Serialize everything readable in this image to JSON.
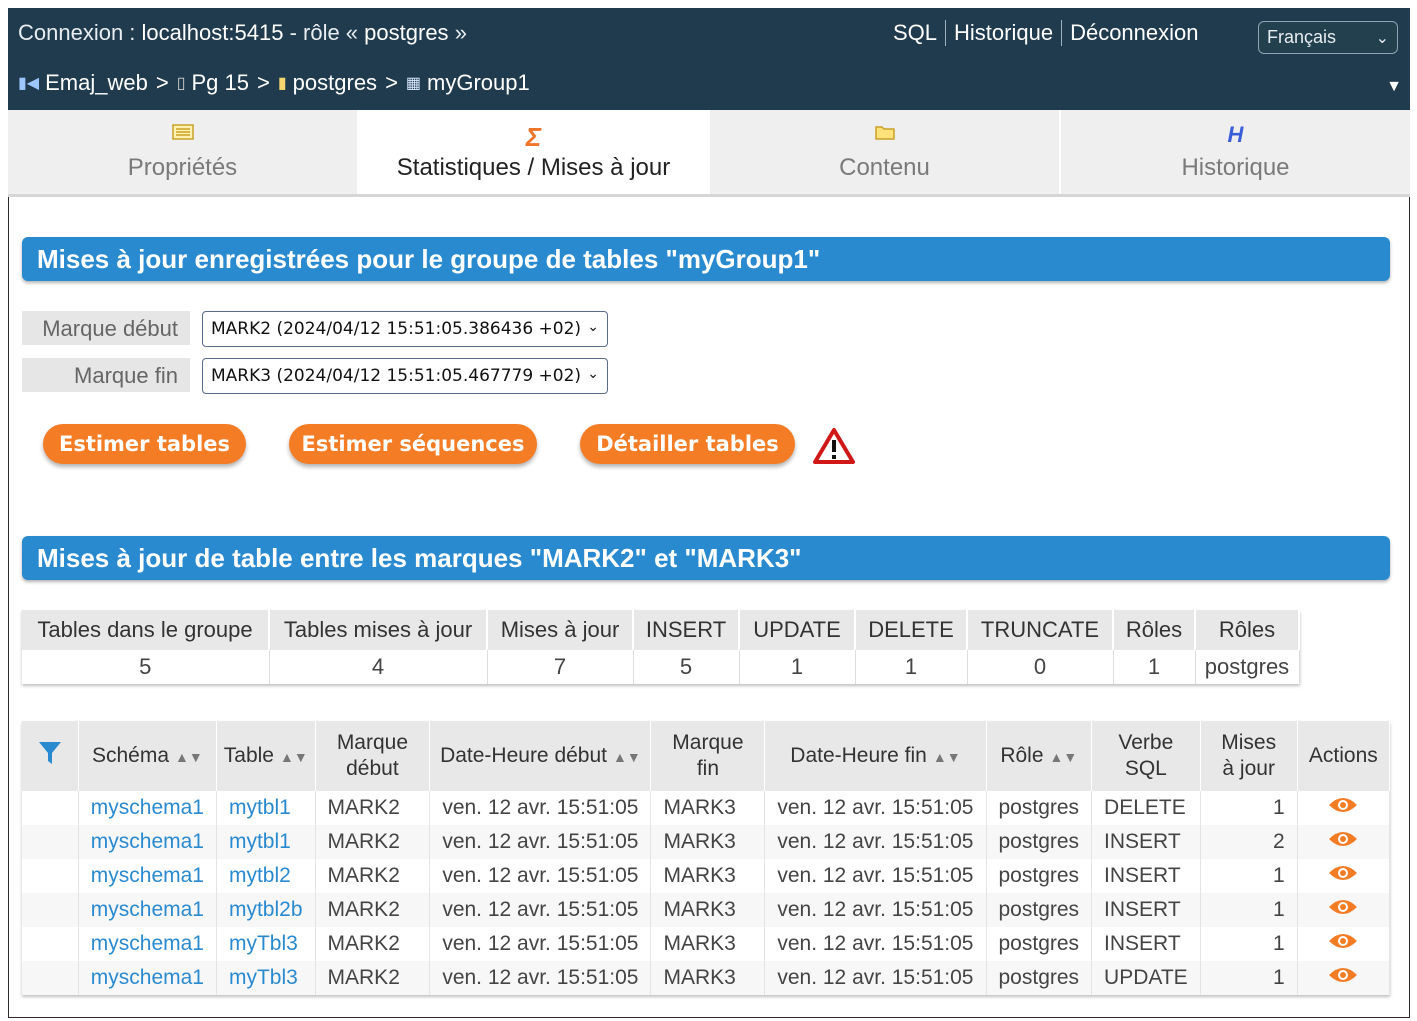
{
  "header": {
    "connection_prefix": "Connexion :",
    "host": "localhost:5415",
    "role_prefix": "- rôle «",
    "role": "postgres",
    "role_suffix": "»",
    "links": [
      "SQL",
      "Historique",
      "Déconnexion"
    ],
    "language": "Français"
  },
  "breadcrumb": {
    "items": [
      "Emaj_web",
      "Pg 15",
      "postgres",
      "myGroup1"
    ],
    "separator": ">"
  },
  "tabs": [
    {
      "label": "Propriétés",
      "icon": "properties-icon"
    },
    {
      "label": "Statistiques / Mises à jour",
      "icon": "sigma-icon",
      "active": true
    },
    {
      "label": "Contenu",
      "icon": "folder-icon"
    },
    {
      "label": "Historique",
      "icon": "history-icon",
      "glyph": "H"
    }
  ],
  "section1": {
    "title": "Mises à jour enregistrées pour le groupe de tables \"myGroup1\"",
    "mark_start_label": "Marque début",
    "mark_start_value": "MARK2 (2024/04/12 15:51:05.386436 +02)",
    "mark_end_label": "Marque fin",
    "mark_end_value": "MARK3 (2024/04/12 15:51:05.467779 +02)",
    "buttons": [
      "Estimer tables",
      "Estimer séquences",
      "Détailler tables"
    ]
  },
  "section2": {
    "title": "Mises à jour de table entre les marques \"MARK2\" et \"MARK3\""
  },
  "summary": {
    "headers": [
      "Tables dans le groupe",
      "Tables mises à jour",
      "Mises à jour",
      "INSERT",
      "UPDATE",
      "DELETE",
      "TRUNCATE",
      "Rôles",
      "Rôles"
    ],
    "values": [
      "5",
      "4",
      "7",
      "5",
      "1",
      "1",
      "0",
      "1",
      "postgres"
    ]
  },
  "details": {
    "headers": {
      "schema": "Schéma",
      "table": "Table",
      "mark_start_1": "Marque",
      "mark_start_2": "début",
      "datetime_start": "Date-Heure début",
      "mark_end_1": "Marque",
      "mark_end_2": "fin",
      "datetime_end": "Date-Heure fin",
      "role": "Rôle",
      "verb_1": "Verbe",
      "verb_2": "SQL",
      "updates_1": "Mises",
      "updates_2": "à jour",
      "actions": "Actions"
    },
    "rows": [
      {
        "schema": "myschema1",
        "table": "mytbl1",
        "mark_start": "MARK2",
        "dt_start": "ven. 12 avr. 15:51:05",
        "mark_end": "MARK3",
        "dt_end": "ven. 12 avr. 15:51:05",
        "role": "postgres",
        "verb": "DELETE",
        "count": "1"
      },
      {
        "schema": "myschema1",
        "table": "mytbl1",
        "mark_start": "MARK2",
        "dt_start": "ven. 12 avr. 15:51:05",
        "mark_end": "MARK3",
        "dt_end": "ven. 12 avr. 15:51:05",
        "role": "postgres",
        "verb": "INSERT",
        "count": "2"
      },
      {
        "schema": "myschema1",
        "table": "mytbl2",
        "mark_start": "MARK2",
        "dt_start": "ven. 12 avr. 15:51:05",
        "mark_end": "MARK3",
        "dt_end": "ven. 12 avr. 15:51:05",
        "role": "postgres",
        "verb": "INSERT",
        "count": "1"
      },
      {
        "schema": "myschema1",
        "table": "mytbl2b",
        "mark_start": "MARK2",
        "dt_start": "ven. 12 avr. 15:51:05",
        "mark_end": "MARK3",
        "dt_end": "ven. 12 avr. 15:51:05",
        "role": "postgres",
        "verb": "INSERT",
        "count": "1"
      },
      {
        "schema": "myschema1",
        "table": "myTbl3",
        "mark_start": "MARK2",
        "dt_start": "ven. 12 avr. 15:51:05",
        "mark_end": "MARK3",
        "dt_end": "ven. 12 avr. 15:51:05",
        "role": "postgres",
        "verb": "INSERT",
        "count": "1"
      },
      {
        "schema": "myschema1",
        "table": "myTbl3",
        "mark_start": "MARK2",
        "dt_start": "ven. 12 avr. 15:51:05",
        "mark_end": "MARK3",
        "dt_end": "ven. 12 avr. 15:51:05",
        "role": "postgres",
        "verb": "UPDATE",
        "count": "1"
      }
    ]
  },
  "colors": {
    "topbar": "#1f3b4d",
    "section": "#2a8ad0",
    "button": "#f47c25",
    "link": "#2a8ad0",
    "eye": "#f47c25"
  }
}
